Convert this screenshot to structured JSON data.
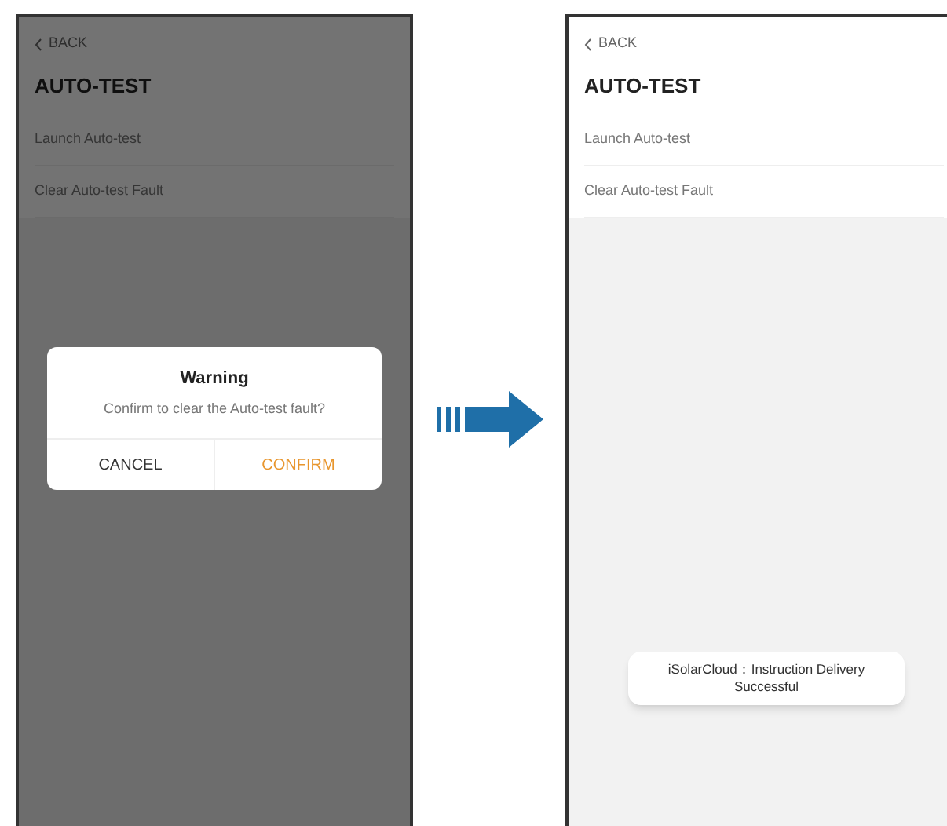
{
  "screens": [
    {
      "back": "BACK",
      "title": "AUTO-TEST",
      "items": [
        "Launch Auto-test",
        "Clear Auto-test Fault"
      ],
      "dimmed": true,
      "dialog": {
        "title": "Warning",
        "message": "Confirm to clear the Auto-test fault?",
        "buttons": [
          {
            "label": "CANCEL",
            "kind": "cancel"
          },
          {
            "label": "CONFIRM",
            "kind": "confirm"
          }
        ]
      }
    },
    {
      "back": "BACK",
      "title": "AUTO-TEST",
      "items": [
        "Launch Auto-test",
        "Clear Auto-test Fault"
      ],
      "dimmed": false,
      "toast": "iSolarCloud：Instruction Delivery Successful"
    }
  ]
}
